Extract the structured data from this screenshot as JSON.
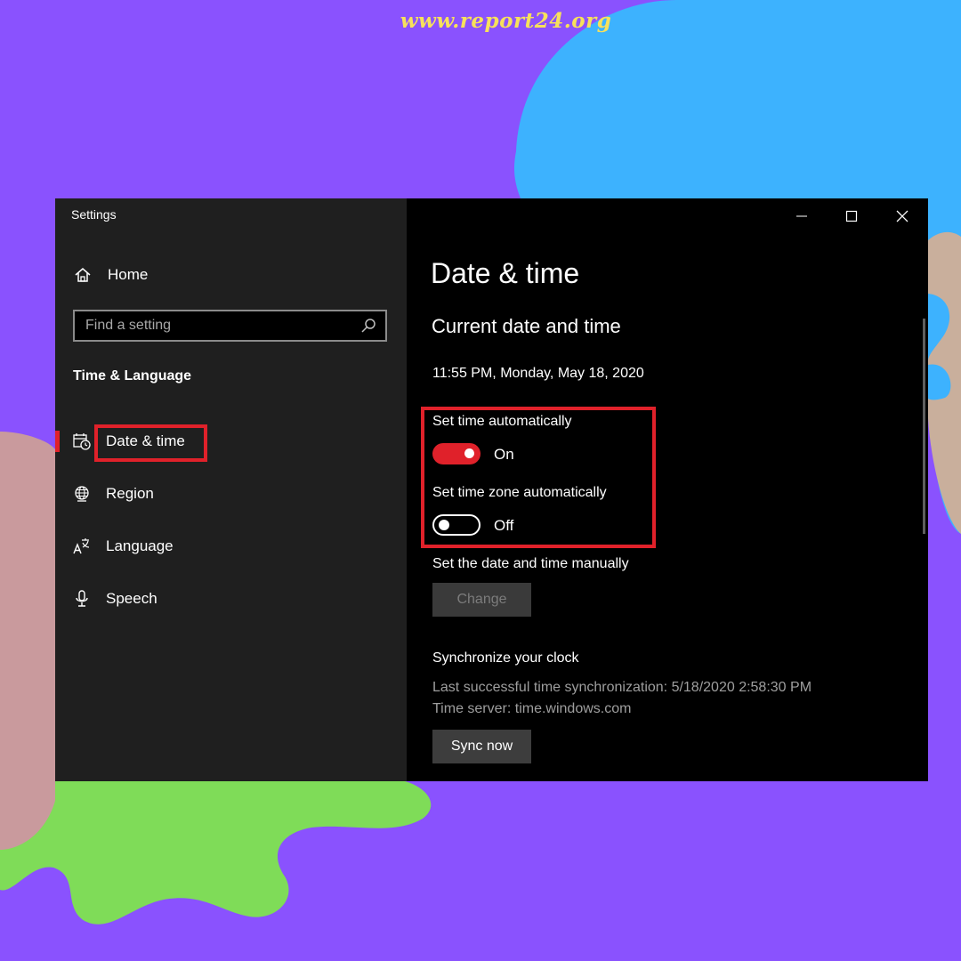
{
  "watermark": "www.report24.org",
  "window": {
    "title": "Settings",
    "controls": {
      "minimize": "minimize-icon",
      "maximize": "maximize-icon",
      "close": "close-icon"
    }
  },
  "sidebar": {
    "home_label": "Home",
    "search_placeholder": "Find a setting",
    "section_title": "Time & Language",
    "items": [
      {
        "label": "Date & time",
        "icon": "calendar-clock-icon",
        "active": true
      },
      {
        "label": "Region",
        "icon": "globe-icon"
      },
      {
        "label": "Language",
        "icon": "language-icon"
      },
      {
        "label": "Speech",
        "icon": "microphone-icon"
      }
    ]
  },
  "main": {
    "page_title": "Date & time",
    "section_title": "Current date and time",
    "current_datetime": "11:55 PM, Monday, May 18, 2020",
    "set_time_auto": {
      "label": "Set time automatically",
      "state": "On"
    },
    "set_timezone_auto": {
      "label": "Set time zone automatically",
      "state": "Off"
    },
    "manual": {
      "label": "Set the date and time manually",
      "button": "Change"
    },
    "sync": {
      "title": "Synchronize your clock",
      "last_sync": "Last successful time synchronization: 5/18/2020 2:58:30 PM",
      "time_server": "Time server: time.windows.com",
      "button": "Sync now"
    }
  },
  "colors": {
    "accent": "#e0212a",
    "background": "#8a52fe",
    "sidebar": "#1f1f1f",
    "content": "#000000"
  }
}
